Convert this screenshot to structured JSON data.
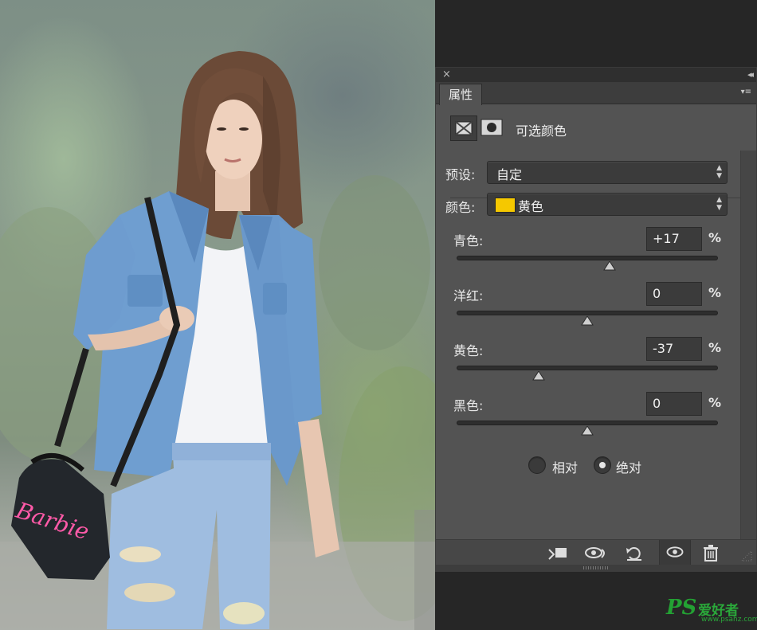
{
  "panel": {
    "close_glyph": "×",
    "collapse_glyph": "◂◂",
    "tab_label": "属性",
    "menu_glyph": "▾≡",
    "adjustment_title": "可选颜色",
    "preset_label": "预设:",
    "preset_value": "自定",
    "colors_label": "颜色:",
    "colors_value": "黄色",
    "colors_swatch": "#f5c800",
    "sliders": [
      {
        "label": "青色:",
        "value": "+17",
        "unit": "%",
        "level": 0.585
      },
      {
        "label": "洋红:",
        "value": "0",
        "unit": "%",
        "level": 0.5
      },
      {
        "label": "黄色:",
        "value": "-37",
        "unit": "%",
        "level": 0.315
      },
      {
        "label": "黑色:",
        "value": "0",
        "unit": "%",
        "level": 0.5
      }
    ],
    "method": {
      "relative_label": "相对",
      "absolute_label": "绝对",
      "selected": "absolute"
    },
    "bottom_icons": [
      "clip-to-layer-icon",
      "view-previous-state-icon",
      "reset-icon",
      "visibility-eye-icon",
      "delete-trash-icon"
    ]
  },
  "photo": {
    "bag_text": "Barbie"
  },
  "watermark": {
    "ps": "PS",
    "cn": "爱好者",
    "url": "www.psahz.com"
  }
}
